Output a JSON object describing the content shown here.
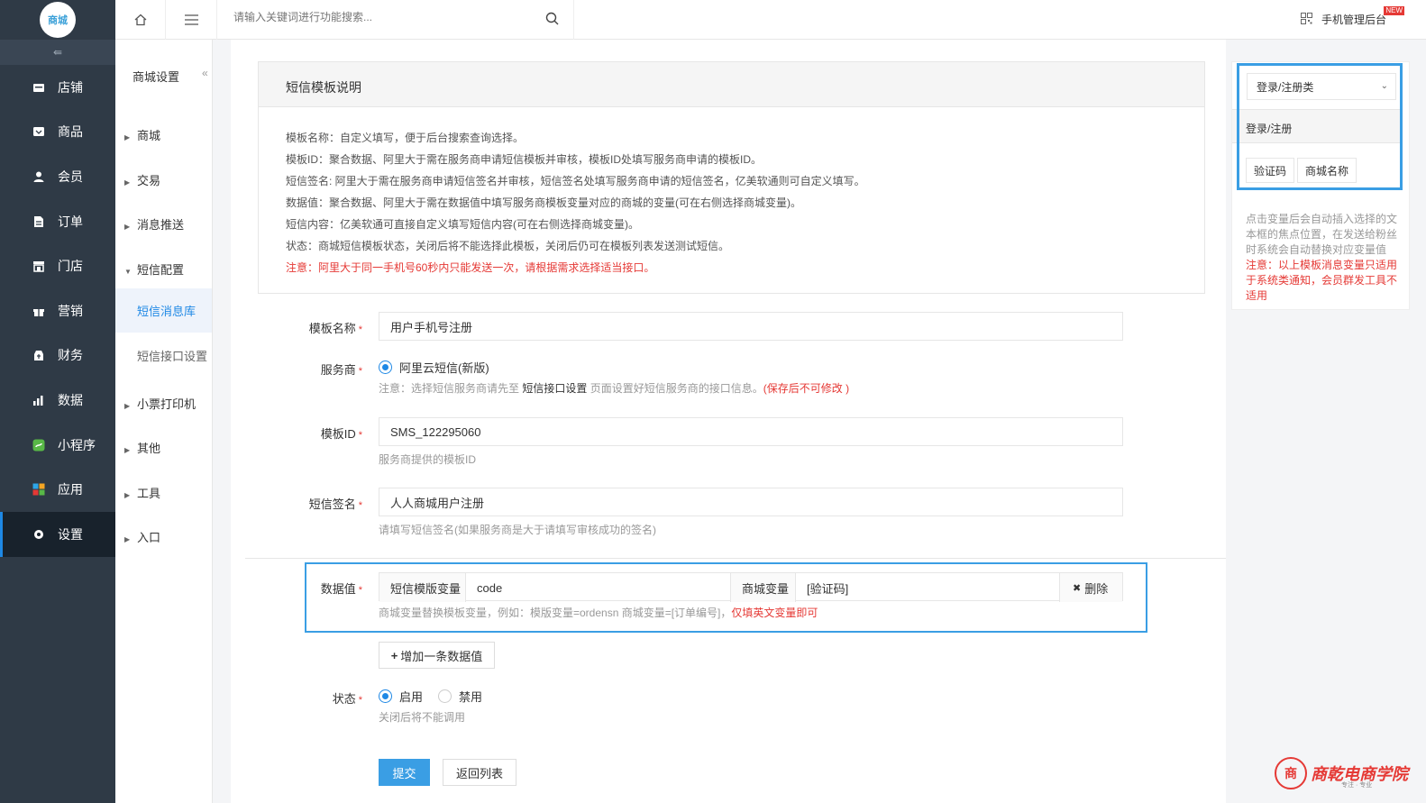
{
  "logo_text": "商城",
  "sidebar": {
    "items": [
      {
        "label": "店铺",
        "icon": "store-icon"
      },
      {
        "label": "商品",
        "icon": "goods-icon"
      },
      {
        "label": "会员",
        "icon": "member-icon"
      },
      {
        "label": "订单",
        "icon": "order-icon"
      },
      {
        "label": "门店",
        "icon": "shop-icon"
      },
      {
        "label": "营销",
        "icon": "gift-icon"
      },
      {
        "label": "财务",
        "icon": "finance-icon"
      },
      {
        "label": "数据",
        "icon": "chart-icon"
      },
      {
        "label": "小程序",
        "icon": "miniprogram-icon"
      },
      {
        "label": "应用",
        "icon": "apps-icon"
      },
      {
        "label": "设置",
        "icon": "gear-icon"
      }
    ],
    "active": "设置"
  },
  "submenu": {
    "title": "商城设置",
    "groups": [
      "商城",
      "交易",
      "消息推送",
      "短信配置",
      "小票打印机",
      "其他",
      "工具",
      "入口"
    ],
    "children": [
      "短信消息库",
      "短信接口设置"
    ]
  },
  "topbar": {
    "search_placeholder": "请输入关键词进行功能搜索...",
    "mobile_admin": "手机管理后台",
    "new_badge": "NEW"
  },
  "info": {
    "title": "短信模板说明",
    "lines": [
      "模板名称：自定义填写，便于后台搜索查询选择。",
      "模板ID：聚合数据、阿里大于需在服务商申请短信模板并审核，模板ID处填写服务商申请的模板ID。",
      "短信签名: 阿里大于需在服务商申请短信签名并审核，短信签名处填写服务商申请的短信签名，亿美软通则可自定义填写。",
      "数据值：聚合数据、阿里大于需在数据值中填写服务商模板变量对应的商城的变量(可在右侧选择商城变量)。",
      "短信内容：亿美软通可直接自定义填写短信内容(可在右侧选择商城变量)。",
      "状态：商城短信模板状态，关闭后将不能选择此模板，关闭后仍可在模板列表发送测试短信。"
    ],
    "warning": "注意：阿里大于同一手机号60秒内只能发送一次，请根据需求选择适当接口。"
  },
  "form": {
    "name_label": "模板名称",
    "name_value": "用户手机号注册",
    "provider_label": "服务商",
    "provider_option": "阿里云短信(新版)",
    "provider_hint_prefix": "注意：选择短信服务商请先至",
    "provider_hint_link": "短信接口设置",
    "provider_hint_mid": "页面设置好短信服务商的接口信息。",
    "provider_hint_warn": "(保存后不可修改 )",
    "id_label": "模板ID",
    "id_value": "SMS_122295060",
    "id_hint": "服务商提供的模板ID",
    "sign_label": "短信签名",
    "sign_value": "人人商城用户注册",
    "sign_hint": "请填写短信签名(如果服务商是大于请填写审核成功的签名)",
    "data_label": "数据值",
    "var_addon": "短信模版变量",
    "var_value": "code",
    "shop_var_addon": "商城变量",
    "shop_var_value": "[验证码]",
    "delete_label": "删除",
    "data_hint": "商城变量替换模板变量，例如：模版变量=ordensn 商城变量=[订单编号]，",
    "data_hint_warn": "仅填英文变量即可",
    "add_label": "增加一条数据值",
    "status_label": "状态",
    "status_on": "启用",
    "status_off": "禁用",
    "status_hint": "关闭后将不能调用",
    "submit": "提交",
    "back": "返回列表"
  },
  "right_panel": {
    "select_value": "登录/注册类",
    "category": "登录/注册",
    "tags": [
      "验证码",
      "商城名称"
    ],
    "note": "点击变量后会自动插入选择的文本框的焦点位置，在发送给粉丝时系统会自动替换对应变量值",
    "warn": "注意：以上模板消息变量只适用于系统类通知，会员群发工具不适用"
  },
  "watermark": {
    "text": "商乾电商学院",
    "sub": "专注 · 专业"
  },
  "colors": {
    "accent": "#1e88e5",
    "highlight": "#3a9ee4",
    "warn": "#e53935",
    "sidebar": "#2f3a46"
  }
}
